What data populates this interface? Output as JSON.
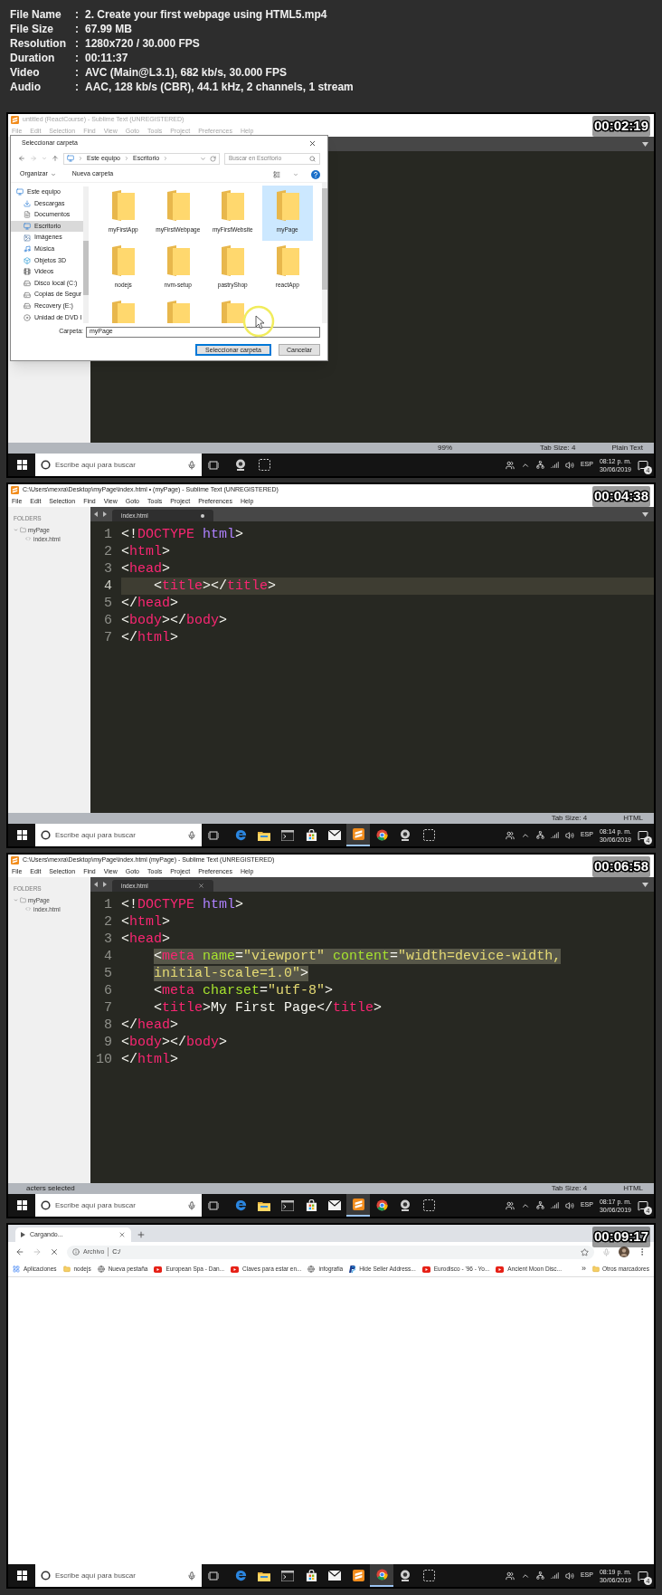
{
  "separator": ":",
  "file_info": [
    {
      "label": "File Name",
      "value": "2. Create your first webpage using HTML5.mp4"
    },
    {
      "label": "File Size",
      "value": "67.99 MB"
    },
    {
      "label": "Resolution",
      "value": "1280x720 / 30.000 FPS"
    },
    {
      "label": "Duration",
      "value": "00:11:37"
    },
    {
      "label": "Video",
      "value": "AVC (Main@L3.1), 682 kb/s, 30.000 FPS"
    },
    {
      "label": "Audio",
      "value": "AAC, 128 kb/s (CBR), 44.1 kHz, 2 channels, 1 stream"
    }
  ],
  "frames": [
    {
      "kind": "sublime",
      "timestamp": "00:02:19",
      "window_title": "untitled (ReactCourse) - Sublime Text (UNREGISTERED)",
      "window_active": false,
      "menu": [
        "File",
        "Edit",
        "Selection",
        "Find",
        "View",
        "Goto",
        "Tools",
        "Project",
        "Preferences",
        "Help"
      ],
      "dialog": {
        "title": "Seleccionar carpeta",
        "breadcrumb": [
          "Este equipo",
          "Escritorio"
        ],
        "search_placeholder": "Buscar en Escritorio",
        "organize": "Organizar",
        "new_folder": "Nueva carpeta",
        "nav": [
          {
            "label": "Este equipo",
            "kind": "pc",
            "selected": false,
            "children": [
              {
                "label": "Descargas",
                "kind": "download",
                "selected": false
              },
              {
                "label": "Documentos",
                "kind": "document",
                "selected": false
              },
              {
                "label": "Escritorio",
                "kind": "desktop",
                "selected": true
              },
              {
                "label": "Imágenes",
                "kind": "image",
                "selected": false
              },
              {
                "label": "Música",
                "kind": "music",
                "selected": false
              },
              {
                "label": "Objetos 3D",
                "kind": "cube",
                "selected": false
              },
              {
                "label": "Videos",
                "kind": "video",
                "selected": false
              },
              {
                "label": "Disco local (C:)",
                "kind": "drive",
                "selected": false
              },
              {
                "label": "Copias de Segur",
                "kind": "drive",
                "selected": false
              },
              {
                "label": "Recovery (E:)",
                "kind": "drive",
                "selected": false
              },
              {
                "label": "Unidad de DVD I",
                "kind": "dvd",
                "selected": false
              }
            ]
          }
        ],
        "folders": [
          {
            "label": "myFirstApp",
            "selected": false
          },
          {
            "label": "myFirstWebpage",
            "selected": false
          },
          {
            "label": "myFirstWebsite",
            "selected": false
          },
          {
            "label": "myPage",
            "selected": true
          },
          {
            "label": "nodejs",
            "selected": false
          },
          {
            "label": "nvm-setup",
            "selected": false
          },
          {
            "label": "pastryShop",
            "selected": false
          },
          {
            "label": "reactApp",
            "selected": false
          },
          {
            "selected": false
          },
          {
            "selected": false
          },
          {
            "selected": false
          }
        ],
        "folder_label": "Carpeta:",
        "folder_value": "myPage",
        "buttons": [
          {
            "label": "Seleccionar carpeta",
            "kind": "primary"
          },
          {
            "label": "Cancelar",
            "kind": "secondary"
          }
        ]
      },
      "status_bar": {
        "center": "99%",
        "right": [
          "Tab Size: 4",
          "Plain Text"
        ]
      },
      "taskbar": {
        "search_placeholder": "Escribe aquí para buscar",
        "apps": [
          {
            "kind": "webcam",
            "selected": false
          },
          {
            "kind": "snip",
            "selected": false
          }
        ],
        "language": "ESP",
        "time": "08:12 p. m.",
        "date": "30/06/2019",
        "notifications": "4"
      }
    },
    {
      "kind": "sublime",
      "timestamp": "00:04:38",
      "window_title": "C:\\Users\\mexra\\Desktop\\myPage\\index.html • (myPage) - Sublime Text (UNREGISTERED)",
      "window_active": true,
      "menu": [
        "File",
        "Edit",
        "Selection",
        "Find",
        "View",
        "Goto",
        "Tools",
        "Project",
        "Preferences",
        "Help"
      ],
      "sidebar": {
        "heading": "FOLDERS",
        "folder": "myPage",
        "file": "index.html"
      },
      "tab": {
        "label": "index.html",
        "dirty": true
      },
      "lines": [
        {
          "number": "1",
          "indented": false,
          "current": false,
          "tokens": [
            {
              "kind": "punct",
              "text": "<!"
            },
            {
              "kind": "keyword",
              "text": "DOCTYPE"
            },
            {
              "kind": "value",
              "text": " html"
            },
            {
              "kind": "punct",
              "text": ">"
            }
          ]
        },
        {
          "number": "2",
          "indented": false,
          "current": false,
          "tokens": [
            {
              "kind": "punct",
              "text": "<"
            },
            {
              "kind": "tag",
              "text": "html"
            },
            {
              "kind": "punct",
              "text": ">"
            }
          ]
        },
        {
          "number": "3",
          "indented": false,
          "current": false,
          "tokens": [
            {
              "kind": "punct",
              "text": "<"
            },
            {
              "kind": "tag",
              "text": "head"
            },
            {
              "kind": "punct",
              "text": ">"
            }
          ]
        },
        {
          "number": "4",
          "indented": true,
          "current": true,
          "tokens": [
            {
              "kind": "punct",
              "text": "<"
            },
            {
              "kind": "tag",
              "text": "title"
            },
            {
              "kind": "punct",
              "text": "></"
            },
            {
              "kind": "tag",
              "text": "title"
            },
            {
              "kind": "punct",
              "text": ">"
            }
          ]
        },
        {
          "number": "5",
          "indented": false,
          "current": false,
          "tokens": [
            {
              "kind": "punct",
              "text": "</"
            },
            {
              "kind": "tag",
              "text": "head"
            },
            {
              "kind": "punct",
              "text": ">"
            }
          ]
        },
        {
          "number": "6",
          "indented": false,
          "current": false,
          "tokens": [
            {
              "kind": "punct",
              "text": "<"
            },
            {
              "kind": "tag",
              "text": "body"
            },
            {
              "kind": "punct",
              "text": "></"
            },
            {
              "kind": "tag",
              "text": "body"
            },
            {
              "kind": "punct",
              "text": ">"
            }
          ]
        },
        {
          "number": "7",
          "indented": false,
          "current": false,
          "tokens": [
            {
              "kind": "punct",
              "text": "</"
            },
            {
              "kind": "tag",
              "text": "html"
            },
            {
              "kind": "punct",
              "text": ">"
            }
          ]
        }
      ],
      "status_bar": {
        "right": [
          "Tab Size: 4",
          "HTML"
        ]
      },
      "taskbar": {
        "search_placeholder": "Escribe aquí para buscar",
        "apps": [
          {
            "kind": "edge",
            "selected": false
          },
          {
            "kind": "explorer",
            "selected": false
          },
          {
            "kind": "terminal",
            "selected": false
          },
          {
            "kind": "store",
            "selected": false
          },
          {
            "kind": "mail",
            "selected": false
          },
          {
            "kind": "sublime",
            "selected": true
          },
          {
            "kind": "chrome",
            "selected": false
          },
          {
            "kind": "webcam",
            "selected": false
          },
          {
            "kind": "snip",
            "selected": false
          }
        ],
        "language": "ESP",
        "time": "08:14 p. m.",
        "date": "30/06/2019",
        "notifications": "4"
      }
    },
    {
      "kind": "sublime",
      "timestamp": "00:06:58",
      "window_title": "C:\\Users\\mexra\\Desktop\\myPage\\index.html (myPage) - Sublime Text (UNREGISTERED)",
      "window_active": true,
      "menu": [
        "File",
        "Edit",
        "Selection",
        "Find",
        "View",
        "Goto",
        "Tools",
        "Project",
        "Preferences",
        "Help"
      ],
      "sidebar": {
        "heading": "FOLDERS",
        "folder": "myPage",
        "file": "index.html"
      },
      "tab": {
        "label": "index.html",
        "dirty": false
      },
      "lines": [
        {
          "number": "1",
          "indented": false,
          "selected": false,
          "tokens": [
            {
              "kind": "punct",
              "text": "<!"
            },
            {
              "kind": "keyword",
              "text": "DOCTYPE"
            },
            {
              "kind": "value",
              "text": " html"
            },
            {
              "kind": "punct",
              "text": ">"
            }
          ]
        },
        {
          "number": "2",
          "indented": false,
          "selected": false,
          "tokens": [
            {
              "kind": "punct",
              "text": "<"
            },
            {
              "kind": "tag",
              "text": "html"
            },
            {
              "kind": "punct",
              "text": ">"
            }
          ]
        },
        {
          "number": "3",
          "indented": false,
          "selected": false,
          "tokens": [
            {
              "kind": "punct",
              "text": "<"
            },
            {
              "kind": "tag",
              "text": "head"
            },
            {
              "kind": "punct",
              "text": ">"
            }
          ]
        },
        {
          "number": "4",
          "indented": true,
          "selected": true,
          "tokens": [
            {
              "kind": "punct",
              "text": "<"
            },
            {
              "kind": "tag",
              "text": "meta"
            },
            {
              "kind": "attr",
              "text": " name"
            },
            {
              "kind": "punct",
              "text": "="
            },
            {
              "kind": "string",
              "text": "\"viewport\""
            },
            {
              "kind": "attr",
              "text": " content"
            },
            {
              "kind": "punct",
              "text": "="
            },
            {
              "kind": "string",
              "text": "\"width=device-width,"
            }
          ]
        },
        {
          "number": "5",
          "indented": true,
          "selected": true,
          "tokens": [
            {
              "kind": "string",
              "text": "initial-scale=1.0\""
            },
            {
              "kind": "punct",
              "text": ">"
            }
          ]
        },
        {
          "number": "6",
          "indented": true,
          "selected": false,
          "tokens": [
            {
              "kind": "punct",
              "text": "<"
            },
            {
              "kind": "tag",
              "text": "meta"
            },
            {
              "kind": "attr",
              "text": " charset"
            },
            {
              "kind": "punct",
              "text": "="
            },
            {
              "kind": "string",
              "text": "\"utf-8\""
            },
            {
              "kind": "punct",
              "text": ">"
            }
          ]
        },
        {
          "number": "7",
          "indented": true,
          "selected": false,
          "tokens": [
            {
              "kind": "punct",
              "text": "<"
            },
            {
              "kind": "tag",
              "text": "title"
            },
            {
              "kind": "punct",
              "text": ">"
            },
            {
              "kind": "text",
              "text": "My First Page"
            },
            {
              "kind": "punct",
              "text": "</"
            },
            {
              "kind": "tag",
              "text": "title"
            },
            {
              "kind": "punct",
              "text": ">"
            }
          ]
        },
        {
          "number": "8",
          "indented": false,
          "selected": false,
          "tokens": [
            {
              "kind": "punct",
              "text": "</"
            },
            {
              "kind": "tag",
              "text": "head"
            },
            {
              "kind": "punct",
              "text": ">"
            }
          ]
        },
        {
          "number": "9",
          "indented": false,
          "selected": false,
          "tokens": [
            {
              "kind": "punct",
              "text": "<"
            },
            {
              "kind": "tag",
              "text": "body"
            },
            {
              "kind": "punct",
              "text": "></"
            },
            {
              "kind": "tag",
              "text": "body"
            },
            {
              "kind": "punct",
              "text": ">"
            }
          ]
        },
        {
          "number": "10",
          "indented": false,
          "selected": false,
          "tokens": [
            {
              "kind": "punct",
              "text": "</"
            },
            {
              "kind": "tag",
              "text": "html"
            },
            {
              "kind": "punct",
              "text": ">"
            }
          ]
        }
      ],
      "status_bar": {
        "left": "acters selected",
        "right": [
          "Tab Size: 4",
          "HTML"
        ]
      },
      "taskbar": {
        "search_placeholder": "Escribe aquí para buscar",
        "apps": [
          {
            "kind": "edge",
            "selected": false
          },
          {
            "kind": "explorer",
            "selected": false
          },
          {
            "kind": "terminal",
            "selected": false
          },
          {
            "kind": "store",
            "selected": false
          },
          {
            "kind": "mail",
            "selected": false
          },
          {
            "kind": "sublime",
            "selected": true
          },
          {
            "kind": "chrome",
            "selected": false
          },
          {
            "kind": "webcam",
            "selected": false
          },
          {
            "kind": "snip",
            "selected": false
          }
        ],
        "language": "ESP",
        "time": "08:17 p. m.",
        "date": "30/06/2019",
        "notifications": "4"
      }
    },
    {
      "kind": "browser",
      "timestamp": "00:09:17",
      "tab": {
        "label": "Cargando..."
      },
      "address": {
        "scheme": "Archivo",
        "url": "C:/"
      },
      "bookmarks": [
        {
          "kind": "apps",
          "label": "Aplicaciones"
        },
        {
          "kind": "folder",
          "label": "nodejs"
        },
        {
          "kind": "globe",
          "label": "Nueva pestaña"
        },
        {
          "kind": "video",
          "label": "European Spa - Dan..."
        },
        {
          "kind": "video",
          "label": "Claves para estar en..."
        },
        {
          "kind": "globe",
          "label": "infografia"
        },
        {
          "kind": "payment",
          "label": "Hide Seller Address..."
        },
        {
          "kind": "video",
          "label": "Eurodisco - '96 - Yo..."
        },
        {
          "kind": "video",
          "label": "Ancient Moon Disc..."
        }
      ],
      "more": "»",
      "other_bookmarks": "Otros marcadores",
      "taskbar": {
        "search_placeholder": "Escribe aquí para buscar",
        "apps": [
          {
            "kind": "edge",
            "selected": false
          },
          {
            "kind": "explorer",
            "selected": false
          },
          {
            "kind": "terminal",
            "selected": false
          },
          {
            "kind": "store",
            "selected": false
          },
          {
            "kind": "mail",
            "selected": false
          },
          {
            "kind": "sublime",
            "selected": false
          },
          {
            "kind": "chrome",
            "selected": true
          },
          {
            "kind": "webcam",
            "selected": false
          },
          {
            "kind": "snip",
            "selected": false
          }
        ],
        "language": "ESP",
        "time": "08:19 p. m.",
        "date": "30/06/2019",
        "notifications": "4"
      }
    }
  ]
}
